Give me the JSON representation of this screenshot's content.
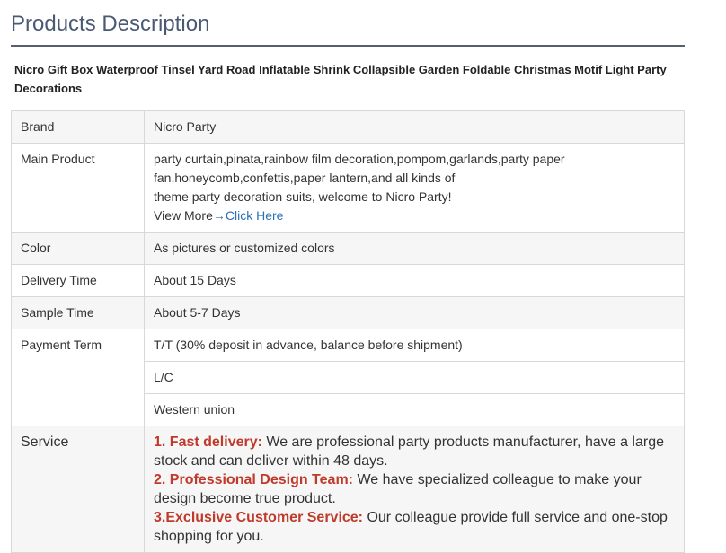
{
  "section_title": "Products Description",
  "product_name": "Nicro Gift Box Waterproof Tinsel Yard Road Inflatable Shrink Collapsible Garden Foldable Christmas Motif Light Party Decorations",
  "table": {
    "brand": {
      "label": "Brand",
      "value": "Nicro Party"
    },
    "main_product": {
      "label": "Main Product",
      "line1": "party curtain,pinata,rainbow film decoration,pompom,garlands,party paper",
      "line2": "fan,honeycomb,confettis,paper lantern,and all kinds of",
      "line3": "theme party decoration suits, welcome to Nicro Party!",
      "view_more_prefix": "View More",
      "arrow": "→",
      "link_text": "Click Here"
    },
    "color": {
      "label": "Color",
      "value": "As pictures or customized colors"
    },
    "delivery_time": {
      "label": "Delivery Time",
      "value": "About 15 Days"
    },
    "sample_time": {
      "label": "Sample Time",
      "value": "About 5-7 Days"
    },
    "payment_term": {
      "label": "Payment Term",
      "options": [
        "T/T (30% deposit in advance, balance before shipment)",
        "L/C",
        "Western union"
      ]
    },
    "service": {
      "label": "Service",
      "items": [
        {
          "head": "1. Fast delivery:",
          "text": "  We are professional party products manufacturer, have a large stock and can deliver within 48 days."
        },
        {
          "head": "2. Professional Design Team:",
          "text": " We have specialized colleague to make your design become true product."
        },
        {
          "head": "3.Exclusive Customer Service:",
          "text": " Our colleague provide full service and one-stop shopping for you."
        }
      ]
    }
  }
}
